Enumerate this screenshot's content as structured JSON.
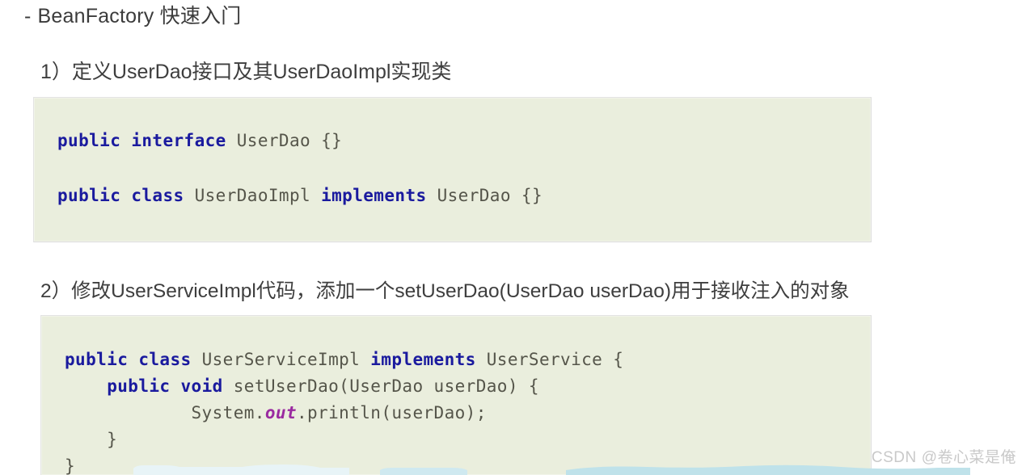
{
  "slide": {
    "title_dash": "-",
    "title": "BeanFactory 快速入门"
  },
  "steps": [
    {
      "heading": "1）定义UserDao接口及其UserDaoImpl实现类",
      "code_block": {
        "language": "java",
        "lines": [
          [
            {
              "t": "public",
              "k": "kw"
            },
            {
              "t": " ",
              "k": "ident"
            },
            {
              "t": "interface",
              "k": "kw"
            },
            {
              "t": " UserDao {}",
              "k": "ident"
            }
          ],
          [
            {
              "t": "public",
              "k": "kw"
            },
            {
              "t": " ",
              "k": "ident"
            },
            {
              "t": "class",
              "k": "kw"
            },
            {
              "t": " UserDaoImpl ",
              "k": "ident"
            },
            {
              "t": "implements",
              "k": "kw"
            },
            {
              "t": " UserDao {}",
              "k": "ident"
            }
          ]
        ]
      }
    },
    {
      "heading": "2）修改UserServiceImpl代码，添加一个setUserDao(UserDao userDao)用于接收注入的对象",
      "code_block": {
        "language": "java",
        "lines": [
          [
            {
              "t": "public",
              "k": "kw"
            },
            {
              "t": " ",
              "k": "ident"
            },
            {
              "t": "class",
              "k": "kw"
            },
            {
              "t": " UserServiceImpl ",
              "k": "ident"
            },
            {
              "t": "implements",
              "k": "kw"
            },
            {
              "t": " UserService {",
              "k": "ident"
            }
          ],
          [
            {
              "t": "    ",
              "k": "ident"
            },
            {
              "t": "public",
              "k": "kw"
            },
            {
              "t": " ",
              "k": "ident"
            },
            {
              "t": "void",
              "k": "kw"
            },
            {
              "t": " setUserDao(UserDao userDao) {",
              "k": "ident"
            }
          ],
          [
            {
              "t": "            System.",
              "k": "ident"
            },
            {
              "t": "out",
              "k": "field"
            },
            {
              "t": ".println(userDao);",
              "k": "ident"
            }
          ],
          [
            {
              "t": "    }",
              "k": "ident"
            }
          ],
          [
            {
              "t": "}",
              "k": "ident"
            }
          ]
        ]
      }
    }
  ],
  "watermark": {
    "brand": "CSDN",
    "author": "@卷心菜是俺"
  },
  "colors": {
    "page_background": "#ffffff",
    "code_background": "#eaeedd",
    "keyword": "#1a1a9e",
    "identifier": "#55554a",
    "field": "#9a2ba0",
    "heading_text": "#3e3e3e",
    "watermark": "#c9c9c9",
    "deco_wave": "#bfe2ea"
  }
}
